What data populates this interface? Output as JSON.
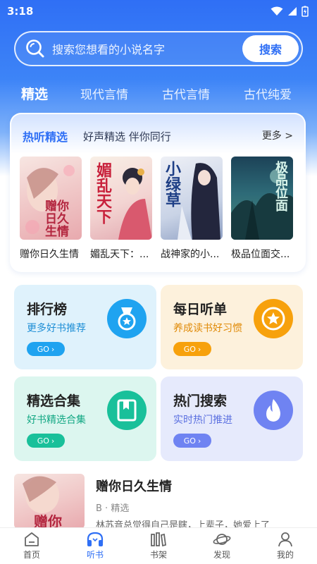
{
  "status": {
    "time": "3:18"
  },
  "search": {
    "placeholder": "搜索您想看的小说名字",
    "button": "搜索"
  },
  "tabs": [
    {
      "label": "精选",
      "active": true
    },
    {
      "label": "现代言情",
      "active": false
    },
    {
      "label": "古代言情",
      "active": false
    },
    {
      "label": "古代纯爱",
      "active": false
    }
  ],
  "hot": {
    "title": "热听精选",
    "subtitle": "好声精选 伴你同行",
    "more": "更多 >",
    "books": [
      {
        "title": "赠你日久生情",
        "cover_text": "赠你日久生情"
      },
      {
        "title": "媚乱天下：...",
        "cover_text": "媚乱天下"
      },
      {
        "title": "战神家的小...",
        "cover_text": "小绿草"
      },
      {
        "title": "极品位面交...",
        "cover_text": "极品位面"
      }
    ]
  },
  "features": [
    {
      "title": "排行榜",
      "subtitle": "更多好书推荐",
      "go": "GO",
      "icon": "medal-icon",
      "color": "#1fa3f0",
      "bg": "#dff2fc"
    },
    {
      "title": "每日听单",
      "subtitle": "养成读书好习惯",
      "go": "GO",
      "icon": "star-badge-icon",
      "color": "#f7a10c",
      "bg": "#fdf1dc"
    },
    {
      "title": "精选合集",
      "subtitle": "好书精选合集",
      "go": "GO",
      "icon": "bookmark-folder-icon",
      "color": "#19c09a",
      "bg": "#dcf6ef"
    },
    {
      "title": "热门搜索",
      "subtitle": "实时热门推进",
      "go": "GO",
      "icon": "flame-icon",
      "color": "#6f83f2",
      "bg": "#e6eafc"
    }
  ],
  "recommend": {
    "title": "赠你日久生情",
    "tag": "B · 精选",
    "desc": "林苏音总觉得自己是瞎，上辈子，她爱上了",
    "cover_text": "赠你"
  },
  "nav": [
    {
      "label": "首页",
      "icon": "home-icon",
      "active": false
    },
    {
      "label": "听书",
      "icon": "headphones-icon",
      "active": true
    },
    {
      "label": "书架",
      "icon": "bookshelf-icon",
      "active": false
    },
    {
      "label": "发现",
      "icon": "planet-icon",
      "active": false
    },
    {
      "label": "我的",
      "icon": "user-icon",
      "active": false
    }
  ],
  "colors": {
    "primary": "#2f6ff5"
  }
}
